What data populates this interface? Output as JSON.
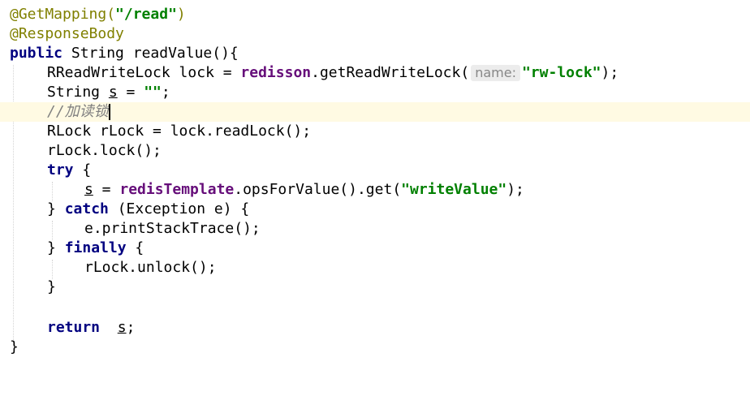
{
  "code": {
    "l1_annotation": "@GetMapping(",
    "l1_path": "\"/read\"",
    "l1_close": ")",
    "l2_annotation": "@ResponseBody",
    "l3_kw_public": "public",
    "l3_rest": " String readValue(){",
    "l4_pre": "RReadWriteLock lock = ",
    "l4_field": "redisson",
    "l4_mid": ".getReadWriteLock(",
    "l4_hint": "name:",
    "l4_str": "\"rw-lock\"",
    "l4_end": ");",
    "l5_pre": "String ",
    "l5_var": "s",
    "l5_mid": " = ",
    "l5_str": "\"\"",
    "l5_end": ";",
    "l6_comment": "//加读锁",
    "l7_text": "RLock rLock = lock.readLock();",
    "l8_text": "rLock.lock();",
    "l9_kw": "try",
    "l9_rest": " {",
    "l10_var": "s",
    "l10_mid": " = ",
    "l10_field": "redisTemplate",
    "l10_call": ".opsForValue().get(",
    "l10_str": "\"writeValue\"",
    "l10_end": ");",
    "l11_open": "} ",
    "l11_kw": "catch",
    "l11_rest": " (Exception e) {",
    "l12_text": "e.printStackTrace();",
    "l13_open": "} ",
    "l13_kw": "finally",
    "l13_rest": " {",
    "l14_text": "rLock.unlock();",
    "l15_text": "}",
    "l17_kw": "return",
    "l17_sp": "  ",
    "l17_var": "s",
    "l17_end": ";",
    "l18_text": "}"
  }
}
